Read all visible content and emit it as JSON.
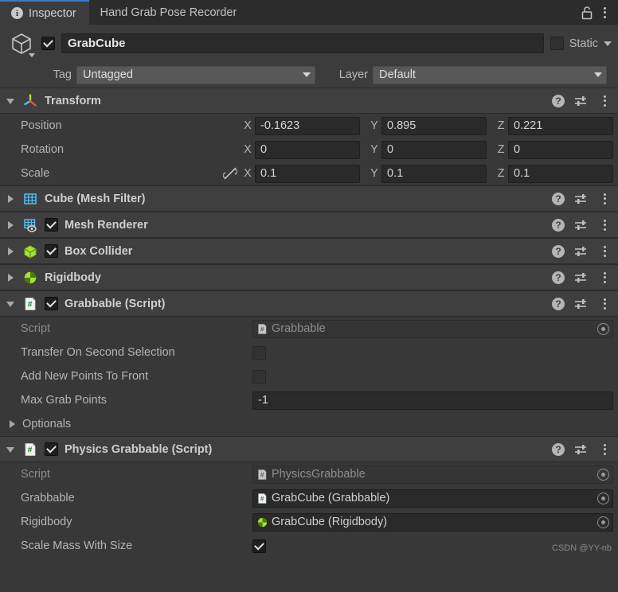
{
  "window": {
    "tabs": [
      {
        "label": "Inspector",
        "icon": "info-icon",
        "active": true
      },
      {
        "label": "Hand Grab Pose Recorder",
        "icon": null,
        "active": false
      }
    ],
    "lock_icon": "lock-open-icon",
    "menu_icon": "kebab-menu-icon"
  },
  "object_header": {
    "icon": "cube-gameobject-icon",
    "enabled": true,
    "name": "GrabCube",
    "static_label": "Static",
    "static_checked": false,
    "static_dropdown_icon": "chevron-down-icon"
  },
  "tag_layer": {
    "tag_label": "Tag",
    "tag_value": "Untagged",
    "layer_label": "Layer",
    "layer_value": "Default"
  },
  "components": [
    {
      "id": "transform",
      "title": "Transform",
      "icon": "transform-axis-icon",
      "expanded": true,
      "has_enable_checkbox": false,
      "help_icon": "help-icon",
      "preset_icon": "preset-icon",
      "menu_icon": "kebab-menu-icon",
      "rows": [
        {
          "label": "Position",
          "x": "-0.1623",
          "y": "0.895",
          "z": "0.221",
          "link_icon": null
        },
        {
          "label": "Rotation",
          "x": "0",
          "y": "0",
          "z": "0",
          "link_icon": null
        },
        {
          "label": "Scale",
          "x": "0.1",
          "y": "0.1",
          "z": "0.1",
          "link_icon": "link-off-icon"
        }
      ],
      "axis_labels": {
        "x": "X",
        "y": "Y",
        "z": "Z"
      }
    },
    {
      "id": "mesh-filter",
      "title": "Cube (Mesh Filter)",
      "icon": "mesh-filter-icon",
      "expanded": false,
      "has_enable_checkbox": false,
      "help_icon": "help-icon",
      "preset_icon": "preset-icon",
      "menu_icon": "kebab-menu-icon"
    },
    {
      "id": "mesh-renderer",
      "title": "Mesh Renderer",
      "icon": "mesh-renderer-icon",
      "expanded": false,
      "has_enable_checkbox": true,
      "enabled": true,
      "help_icon": "help-icon",
      "preset_icon": "preset-icon",
      "menu_icon": "kebab-menu-icon"
    },
    {
      "id": "box-collider",
      "title": "Box Collider",
      "icon": "box-collider-icon",
      "expanded": false,
      "has_enable_checkbox": true,
      "enabled": true,
      "help_icon": "help-icon",
      "preset_icon": "preset-icon",
      "menu_icon": "kebab-menu-icon"
    },
    {
      "id": "rigidbody",
      "title": "Rigidbody",
      "icon": "rigidbody-icon",
      "expanded": false,
      "has_enable_checkbox": false,
      "help_icon": "help-icon",
      "preset_icon": "preset-icon",
      "menu_icon": "kebab-menu-icon"
    },
    {
      "id": "grabbable",
      "title": "Grabbable (Script)",
      "icon": "cs-script-icon",
      "expanded": true,
      "has_enable_checkbox": true,
      "enabled": true,
      "help_icon": "help-icon",
      "preset_icon": "preset-icon",
      "menu_icon": "kebab-menu-icon",
      "props": {
        "script_label": "Script",
        "script_value": "Grabbable",
        "transfer_label": "Transfer On Second Selection",
        "transfer_checked": false,
        "addpoints_label": "Add New Points To Front",
        "addpoints_checked": false,
        "maxgrab_label": "Max Grab Points",
        "maxgrab_value": "-1",
        "optionals_label": "Optionals",
        "optionals_expanded": false
      }
    },
    {
      "id": "physics-grabbable",
      "title": "Physics Grabbable (Script)",
      "icon": "cs-script-icon",
      "expanded": true,
      "has_enable_checkbox": true,
      "enabled": true,
      "help_icon": "help-icon",
      "preset_icon": "preset-icon",
      "menu_icon": "kebab-menu-icon",
      "props": {
        "script_label": "Script",
        "script_value": "PhysicsGrabbable",
        "grabbable_label": "Grabbable",
        "grabbable_value": "GrabCube (Grabbable)",
        "rigidbody_label": "Rigidbody",
        "rigidbody_value": "GrabCube (Rigidbody)",
        "scalemass_label": "Scale Mass With Size",
        "scalemass_checked": true
      }
    }
  ],
  "watermark": "CSDN @YY-nb",
  "colors": {
    "panel_bg": "#383838",
    "header_bg": "#3c3c3c",
    "component_header_bg": "#3f3f3f",
    "tabbar_bg": "#2c2c2c",
    "active_tab_accent": "#3a79c4",
    "field_bg": "#2a2a2a",
    "dropdown_bg": "#585858",
    "unity_green": "#a6e22e",
    "unity_blue": "#4fc3f7"
  }
}
